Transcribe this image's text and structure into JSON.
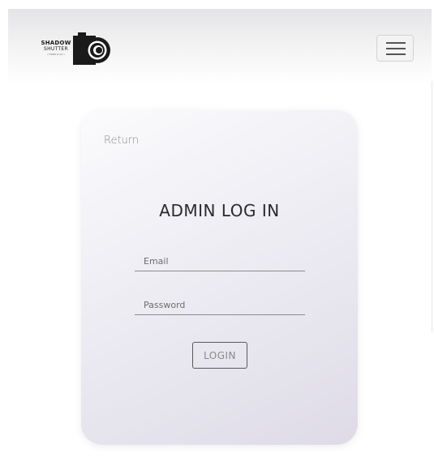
{
  "header": {
    "logo": {
      "line1": "SHADOW",
      "line2": "SHUTTER",
      "line3": "• FILMS & CO •",
      "icon": "camera-icon"
    },
    "menu_toggle": {
      "icon": "hamburger-menu-icon"
    }
  },
  "login_card": {
    "return_label": "Return",
    "title": "ADMIN LOG IN",
    "email": {
      "placeholder": "Email",
      "value": ""
    },
    "password": {
      "placeholder": "Password",
      "value": ""
    },
    "login_label": "LOGIN"
  },
  "colors": {
    "card_gradient_start": "#fbfbfd",
    "card_gradient_end": "#dedbe7",
    "header_gradient_top": "#e4e4e6",
    "text_dark": "#2a2a2a",
    "text_muted": "#8a8a8a",
    "underline": "#8c8c8c",
    "button_border": "#5a5a5a"
  }
}
